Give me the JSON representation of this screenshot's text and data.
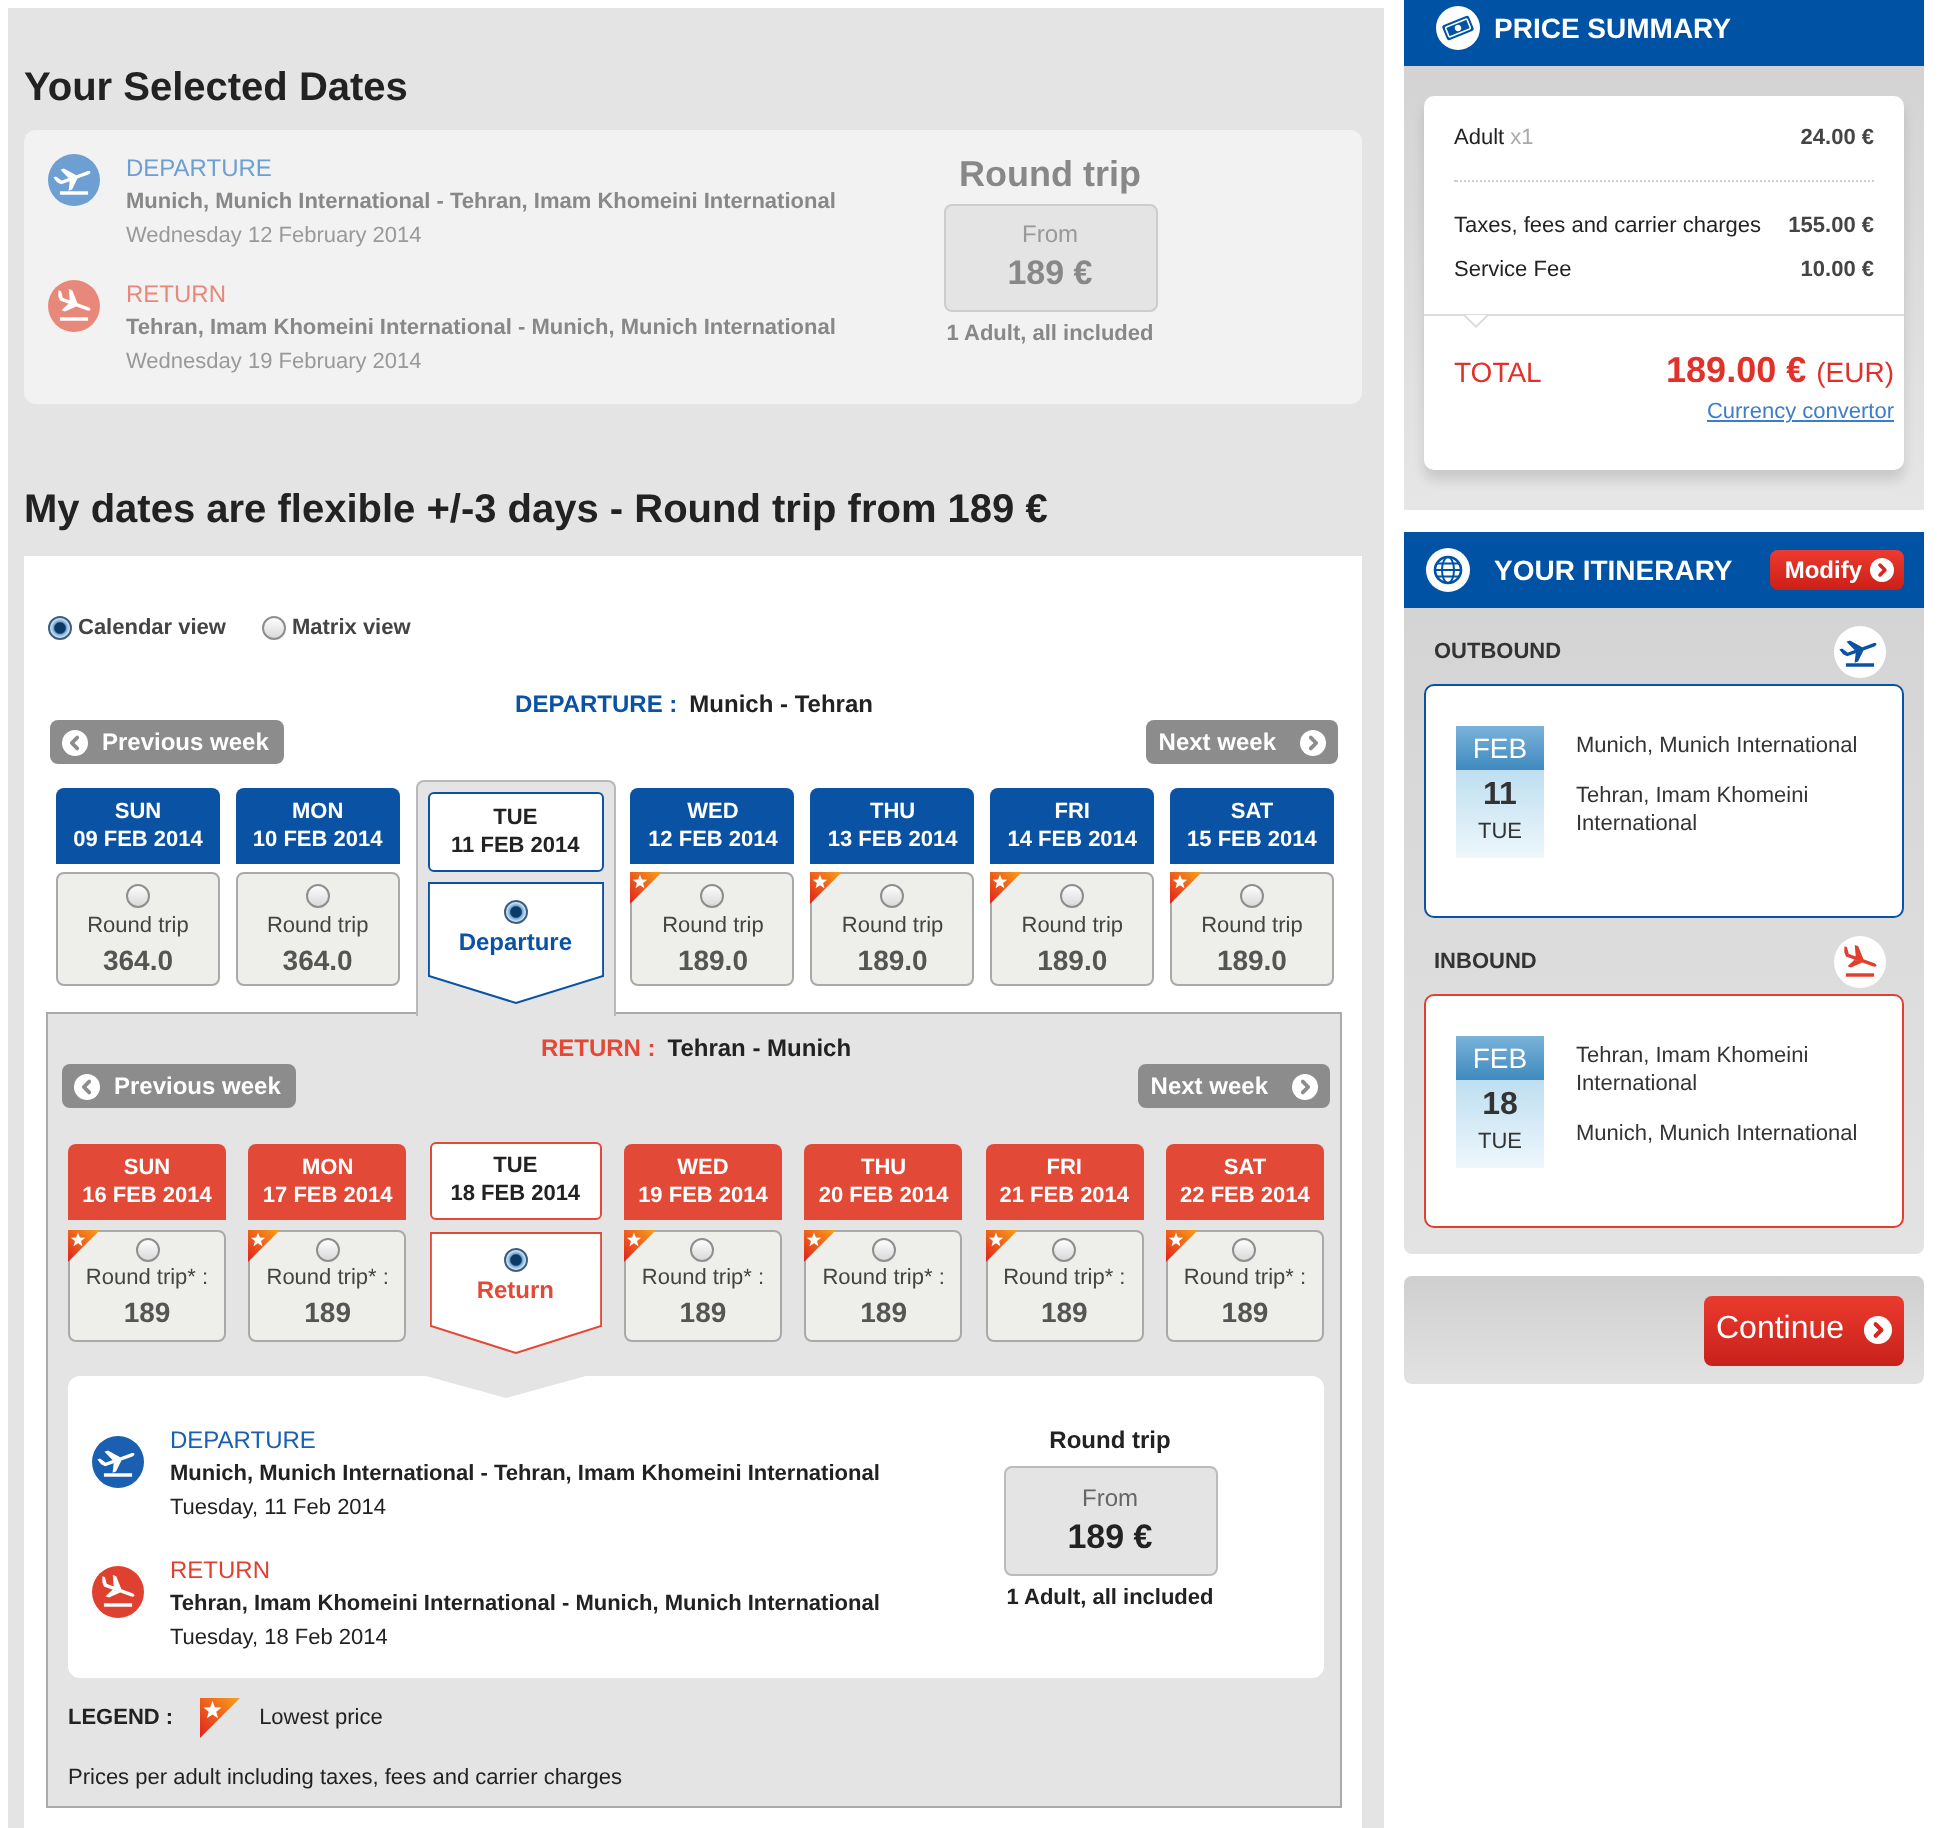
{
  "selected_dates": {
    "title": "Your Selected Dates",
    "legs": [
      {
        "kind": "departure",
        "label": "DEPARTURE",
        "route": "Munich, Munich International - Tehran, Imam Khomeini International",
        "date": "Wednesday 12 February 2014"
      },
      {
        "kind": "return",
        "label": "RETURN",
        "route": "Tehran, Imam Khomeini International - Munich, Munich International",
        "date": "Wednesday 19 February 2014"
      }
    ],
    "fare": {
      "trip_type": "Round trip",
      "from_label": "From",
      "price": "189 €",
      "note": "1 Adult, all included"
    }
  },
  "flexible_dates": {
    "title": "My dates are flexible +/-3 days - Round trip from 189 €",
    "view_options": [
      {
        "label": "Calendar view",
        "selected": true
      },
      {
        "label": "Matrix view",
        "selected": false
      }
    ],
    "calendars": [
      {
        "kind": "departure",
        "label": "DEPARTURE :",
        "route": "Munich - Tehran",
        "previous_week": "Previous week",
        "next_week": "Next week",
        "days": [
          {
            "weekday": "SUN",
            "date": "09 FEB 2014",
            "fare_label": "Round trip",
            "price": "364.0",
            "lowest": false,
            "selected": false
          },
          {
            "weekday": "MON",
            "date": "10 FEB 2014",
            "fare_label": "Round trip",
            "price": "364.0",
            "lowest": false,
            "selected": false
          },
          {
            "weekday": "TUE",
            "date": "11 FEB 2014",
            "selected_label": "Departure",
            "lowest": false,
            "selected": true
          },
          {
            "weekday": "WED",
            "date": "12 FEB 2014",
            "fare_label": "Round trip",
            "price": "189.0",
            "lowest": true,
            "selected": false
          },
          {
            "weekday": "THU",
            "date": "13 FEB 2014",
            "fare_label": "Round trip",
            "price": "189.0",
            "lowest": true,
            "selected": false
          },
          {
            "weekday": "FRI",
            "date": "14 FEB 2014",
            "fare_label": "Round trip",
            "price": "189.0",
            "lowest": true,
            "selected": false
          },
          {
            "weekday": "SAT",
            "date": "15 FEB 2014",
            "fare_label": "Round trip",
            "price": "189.0",
            "lowest": true,
            "selected": false
          }
        ]
      },
      {
        "kind": "return",
        "label": "RETURN :",
        "route": "Tehran - Munich",
        "previous_week": "Previous week",
        "next_week": "Next week",
        "days": [
          {
            "weekday": "SUN",
            "date": "16 FEB 2014",
            "fare_label": "Round trip* :",
            "price": "189",
            "lowest": true,
            "selected": false
          },
          {
            "weekday": "MON",
            "date": "17 FEB 2014",
            "fare_label": "Round trip* :",
            "price": "189",
            "lowest": true,
            "selected": false
          },
          {
            "weekday": "TUE",
            "date": "18 FEB 2014",
            "selected_label": "Return",
            "lowest": false,
            "selected": true
          },
          {
            "weekday": "WED",
            "date": "19 FEB 2014",
            "fare_label": "Round trip* :",
            "price": "189",
            "lowest": true,
            "selected": false
          },
          {
            "weekday": "THU",
            "date": "20 FEB 2014",
            "fare_label": "Round trip* :",
            "price": "189",
            "lowest": true,
            "selected": false
          },
          {
            "weekday": "FRI",
            "date": "21 FEB 2014",
            "fare_label": "Round trip* :",
            "price": "189",
            "lowest": true,
            "selected": false
          },
          {
            "weekday": "SAT",
            "date": "22 FEB 2014",
            "fare_label": "Round trip* :",
            "price": "189",
            "lowest": true,
            "selected": false
          }
        ]
      }
    ],
    "summary": {
      "legs": [
        {
          "kind": "departure",
          "label": "DEPARTURE",
          "route": "Munich, Munich International - Tehran, Imam Khomeini International",
          "date": "Tuesday, 11 Feb 2014"
        },
        {
          "kind": "return",
          "label": "RETURN",
          "route": "Tehran, Imam Khomeini International - Munich, Munich International",
          "date": "Tuesday, 18 Feb 2014"
        }
      ],
      "fare": {
        "trip_type": "Round trip",
        "from_label": "From",
        "price": "189 €",
        "note": "1 Adult, all included"
      }
    },
    "legend": {
      "label": "LEGEND :",
      "text": "Lowest price"
    },
    "footnote": "Prices per adult including taxes, fees and carrier charges"
  },
  "price_summary": {
    "title": "PRICE SUMMARY",
    "lines": [
      {
        "label": "Adult",
        "quantity": "x1",
        "amount": "24.00 €"
      },
      {
        "label": "Taxes, fees and carrier charges",
        "amount": "155.00 €"
      },
      {
        "label": "Service Fee",
        "amount": "10.00 €"
      }
    ],
    "total": {
      "label": "TOTAL",
      "amount": "189.00 €",
      "currency": "(EUR)"
    },
    "link": "Currency convertor"
  },
  "itinerary": {
    "title": "YOUR ITINERARY",
    "modify_button": "Modify",
    "legs": [
      {
        "kind": "outbound",
        "label": "OUTBOUND",
        "month": "FEB",
        "day": "11",
        "weekday": "TUE",
        "from": "Munich, Munich International",
        "to": "Tehran, Imam Khomeini International"
      },
      {
        "kind": "inbound",
        "label": "INBOUND",
        "month": "FEB",
        "day": "18",
        "weekday": "TUE",
        "from": "Tehran, Imam Khomeini International",
        "to": "Munich, Munich International"
      }
    ]
  },
  "continue_button": "Continue"
}
